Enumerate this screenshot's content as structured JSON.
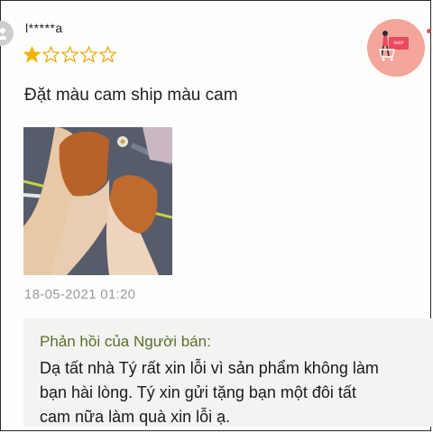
{
  "review": {
    "username": "l*****a",
    "rating": 1,
    "rating_max": 5,
    "text": "Đặt màu cam ship màu cam",
    "date": "18-05-2021 01:20"
  },
  "seller_reply": {
    "title": "Phản hồi của Người bán:",
    "lines": [
      "Dạ tất nhà Tý rất xin lỗi vì sản phẩm không làm",
      "bạn hài lòng. Tý xin gửi tặng bạn một đôi tất",
      "cam nữa làm quà xin lỗi ạ."
    ]
  },
  "colors": {
    "star_filled": "#f2b400",
    "star_empty_stroke": "#e8a800",
    "seller_title": "#5b6f2a",
    "badge_bg": "#f3a59a"
  },
  "icons": {
    "avatar": "user-avatar-icon",
    "star": "star-icon",
    "shop_badge": "shop-badge-icon"
  }
}
